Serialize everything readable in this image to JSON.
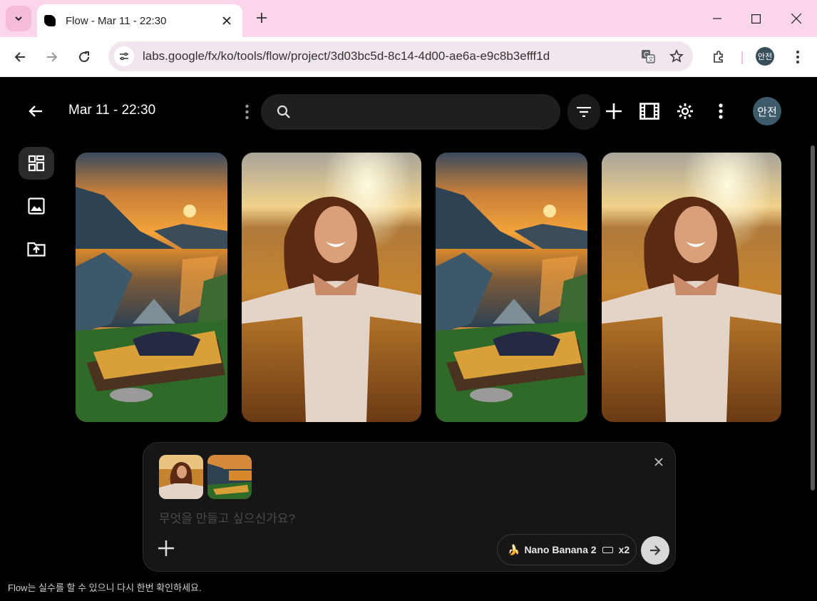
{
  "browser": {
    "tab_title": "Flow - Mar 11 - 22:30",
    "url": "labs.google/fx/ko/tools/flow/project/3d03bc5d-8c14-4d00-ae6a-e9c8b3efff1d",
    "profile_initials": "안전",
    "frame_color": "#fbd6ea"
  },
  "header": {
    "title": "Mar 11 - 22:30",
    "search_value": "",
    "avatar_initials": "안전"
  },
  "sidebar": {
    "items": [
      {
        "icon": "grid-view-icon",
        "active": true
      },
      {
        "icon": "image-icon",
        "active": false
      },
      {
        "icon": "folder-upload-icon",
        "active": false
      }
    ]
  },
  "gallery": {
    "items": [
      {
        "subject": "lake-sunset-bed"
      },
      {
        "subject": "woman-sunset-field"
      },
      {
        "subject": "lake-sunset-bed"
      },
      {
        "subject": "woman-sunset-field"
      }
    ]
  },
  "composer": {
    "placeholder": "무엇을 만들고 싶으신가요?",
    "model_name": "Nano Banana 2",
    "count": "x2",
    "attachments": [
      "woman-sunset-field",
      "lake-sunset-bed"
    ]
  },
  "footer": {
    "disclaimer": "Flow는 실수를 할 수 있으니 다시 한번 확인하세요."
  }
}
